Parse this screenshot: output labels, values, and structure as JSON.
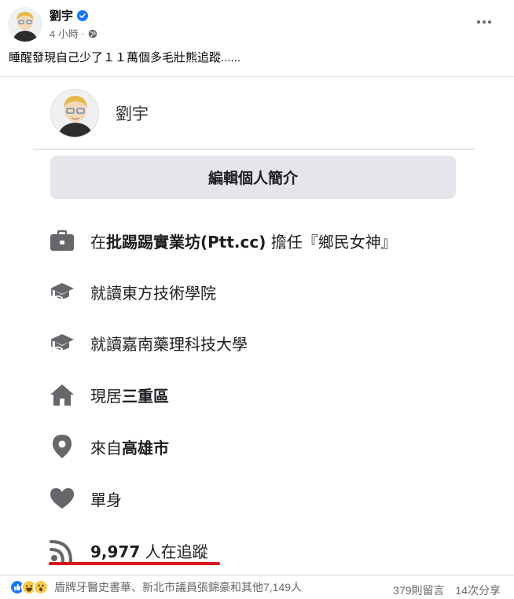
{
  "post": {
    "author": "劉宇",
    "time": "4 小時",
    "dot": "·",
    "text": "睡醒發現自己少了１１萬個多毛壯熊追蹤......"
  },
  "screenshot": {
    "profile_name": "劉宇",
    "edit_button": "編輯個人簡介",
    "work": {
      "prefix": "在",
      "bold": "批踢踢實業坊(Ptt.cc)",
      "suffix": " 擔任『鄉民女神』"
    },
    "school1": "就讀東方技術學院",
    "school2": "就讀嘉南藥理科技大學",
    "lives": {
      "prefix": "現居",
      "bold": "三重區"
    },
    "from": {
      "prefix": "來自",
      "bold": "高雄市"
    },
    "relationship": "單身",
    "followers": {
      "bold": "9,977",
      "suffix": " 人在追蹤"
    }
  },
  "footer": {
    "reaction_names": "盾牌牙醫史書華、新北市議員張錦豪和其他7,149人",
    "comments": "379則留言",
    "shares": "14次分享"
  },
  "colors": {
    "icon_gray": "#65676b",
    "underline_red": "#d8121a",
    "verified_blue": "#1877f2"
  }
}
